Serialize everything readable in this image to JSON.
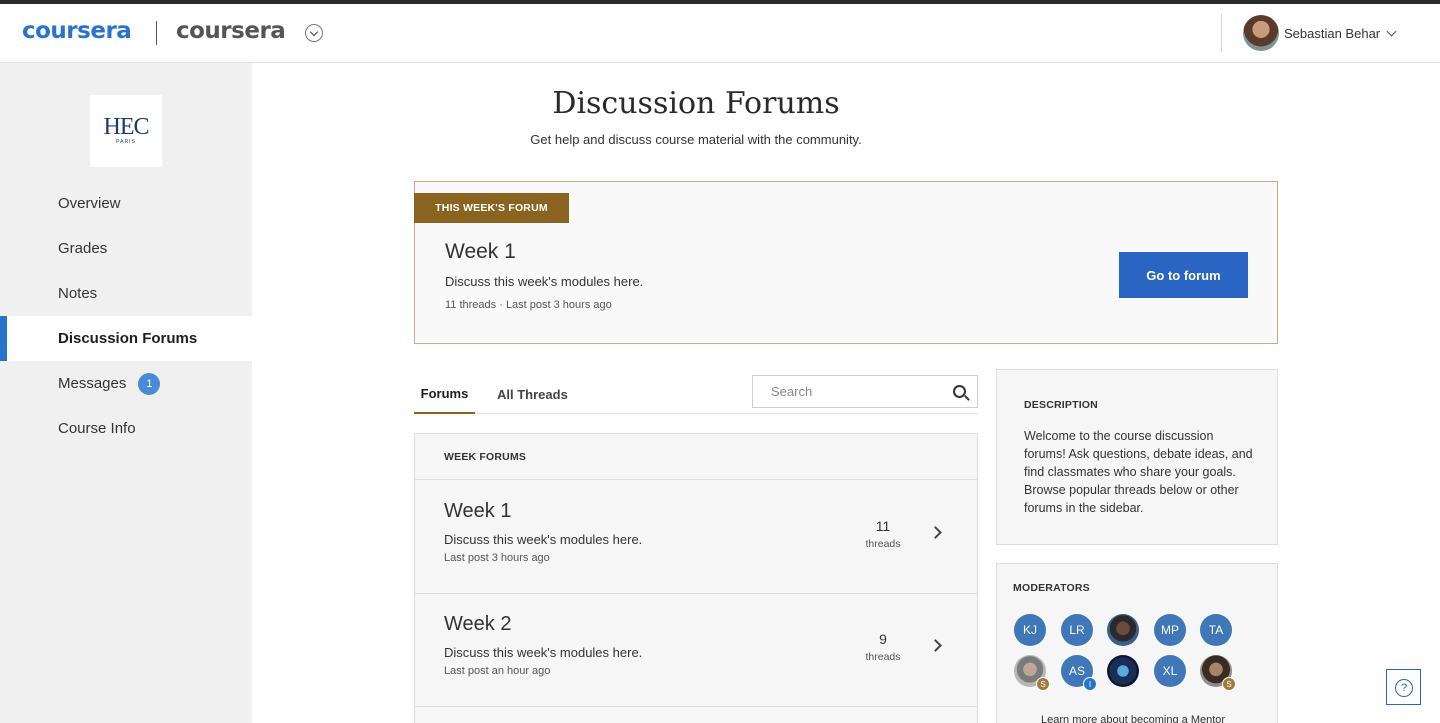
{
  "header": {
    "brand_primary": "coursera",
    "brand_secondary": "coursera",
    "user_name": "Sebastian Behar"
  },
  "sidebar": {
    "partner": {
      "name": "HEC",
      "sub": "PARIS"
    },
    "items": [
      {
        "label": "Overview"
      },
      {
        "label": "Grades"
      },
      {
        "label": "Notes"
      },
      {
        "label": "Discussion Forums",
        "active": true
      },
      {
        "label": "Messages",
        "badge": "1"
      },
      {
        "label": "Course Info"
      }
    ]
  },
  "main": {
    "title": "Discussion Forums",
    "subtitle": "Get help and discuss course material with the community.",
    "featured": {
      "tag": "THIS WEEK'S FORUM",
      "title": "Week 1",
      "description": "Discuss this week's modules here.",
      "meta": "11 threads · Last post 3 hours ago",
      "button_label": "Go to forum"
    },
    "tabs": [
      {
        "label": "Forums",
        "active": true
      },
      {
        "label": "All Threads"
      }
    ],
    "search": {
      "placeholder": "Search",
      "value": ""
    },
    "week_forums": {
      "heading": "WEEK FORUMS",
      "rows": [
        {
          "title": "Week 1",
          "description": "Discuss this week's modules here.",
          "meta": "Last post 3 hours ago",
          "count": "11",
          "count_label": "threads"
        },
        {
          "title": "Week 2",
          "description": "Discuss this week's modules here.",
          "meta": "Last post an hour ago",
          "count": "9",
          "count_label": "threads"
        }
      ]
    }
  },
  "right_panel": {
    "description": {
      "heading": "DESCRIPTION",
      "text": "Welcome to the course discussion forums! Ask questions, debate ideas, and find classmates who share your goals. Browse popular threads below or other forums in the sidebar."
    },
    "moderators": {
      "heading": "MODERATORS",
      "avatars": [
        {
          "initials": "KJ"
        },
        {
          "initials": "LR"
        },
        {
          "initials": "",
          "photo": true
        },
        {
          "initials": "MP"
        },
        {
          "initials": "TA"
        },
        {
          "initials": "",
          "photo": true,
          "badge": "S"
        },
        {
          "initials": "AS",
          "badge": "I"
        },
        {
          "initials": "",
          "photo": true
        },
        {
          "initials": "XL"
        },
        {
          "initials": "",
          "photo": true,
          "badge": "S"
        }
      ],
      "mentor_link": "Learn more about becoming a Mentor"
    }
  },
  "colors": {
    "brand_blue": "#2a73cc",
    "forum_tag": "#8a6321",
    "button_blue": "#2b65c3",
    "moderator_blue": "#3f77b9"
  },
  "icons": [
    "chevron-down-icon",
    "search-icon",
    "chevron-right-icon",
    "help-icon"
  ]
}
